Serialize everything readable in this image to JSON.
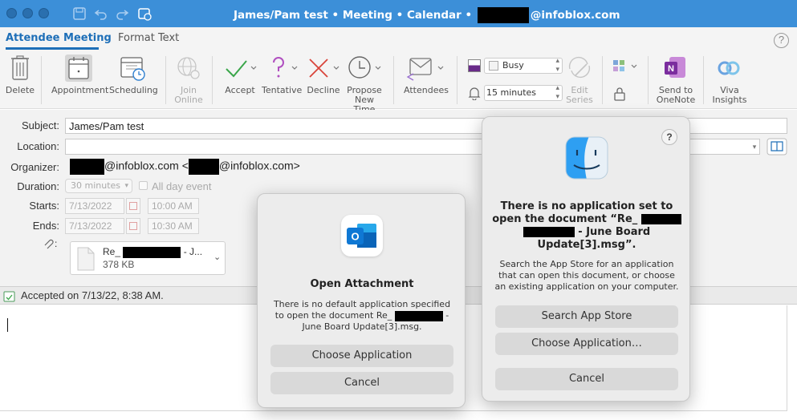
{
  "window": {
    "title_prefix": "James/Pam test • Meeting • Calendar •",
    "title_suffix": "@infoblox.com"
  },
  "tabs": [
    {
      "label": "Attendee Meeting",
      "active": true
    },
    {
      "label": "Format Text",
      "active": false
    }
  ],
  "ribbon": {
    "delete": "Delete",
    "appointment": "Appointment",
    "scheduling": "Scheduling",
    "join_online_1": "Join",
    "join_online_2": "Online",
    "accept": "Accept",
    "tentative": "Tentative",
    "decline": "Decline",
    "propose_1": "Propose",
    "propose_2": "New Time",
    "attendees": "Attendees",
    "show_as": "Busy",
    "reminder": "15 minutes",
    "edit_series_1": "Edit",
    "edit_series_2": "Series",
    "send_onenote_1": "Send to",
    "send_onenote_2": "OneNote",
    "viva_1": "Viva",
    "viva_2": "Insights"
  },
  "form": {
    "subject_label": "Subject:",
    "subject_value": "James/Pam test",
    "location_label": "Location:",
    "location_value": "",
    "organizer_label": "Organizer:",
    "organizer_domain": "@infoblox.com <",
    "organizer_domain2": "@infoblox.com>",
    "duration_label": "Duration:",
    "duration_value": "30 minutes",
    "all_day": "All day event",
    "starts_label": "Starts:",
    "start_date": "7/13/2022",
    "start_time": "10:00 AM",
    "ends_label": "Ends:",
    "end_date": "7/13/2022",
    "end_time": "10:30 AM",
    "attachment_name_prefix": "Re_",
    "attachment_name_suffix": "- J...",
    "attachment_size": "378 KB"
  },
  "status": {
    "accepted_text": "Accepted on 7/13/22, 8:38 AM."
  },
  "dialog_open_attachment": {
    "title": "Open Attachment",
    "text_1": "There is no default application specified",
    "text_2a": "to open the document Re_",
    "text_2b": "-",
    "text_3": "June Board Update[3].msg.",
    "choose_button": "Choose Application",
    "cancel_button": "Cancel"
  },
  "dialog_no_app": {
    "help": "?",
    "title_1": "There is no application set to",
    "title_2": "open the document “Re_",
    "title_3": "- June Board",
    "title_4": "Update[3].msg”.",
    "text_1": "Search the App Store for an application",
    "text_2": "that can open this document, or choose",
    "text_3": "an existing application on your computer.",
    "search_button": "Search App Store",
    "choose_button": "Choose Application…",
    "cancel_button": "Cancel"
  },
  "colors": {
    "titlebar": "#3c8fd8",
    "accent": "#1e6fb8",
    "accept_green": "#3aa64a",
    "decline_red": "#d9443a",
    "tentative_purple": "#b04fc0"
  }
}
